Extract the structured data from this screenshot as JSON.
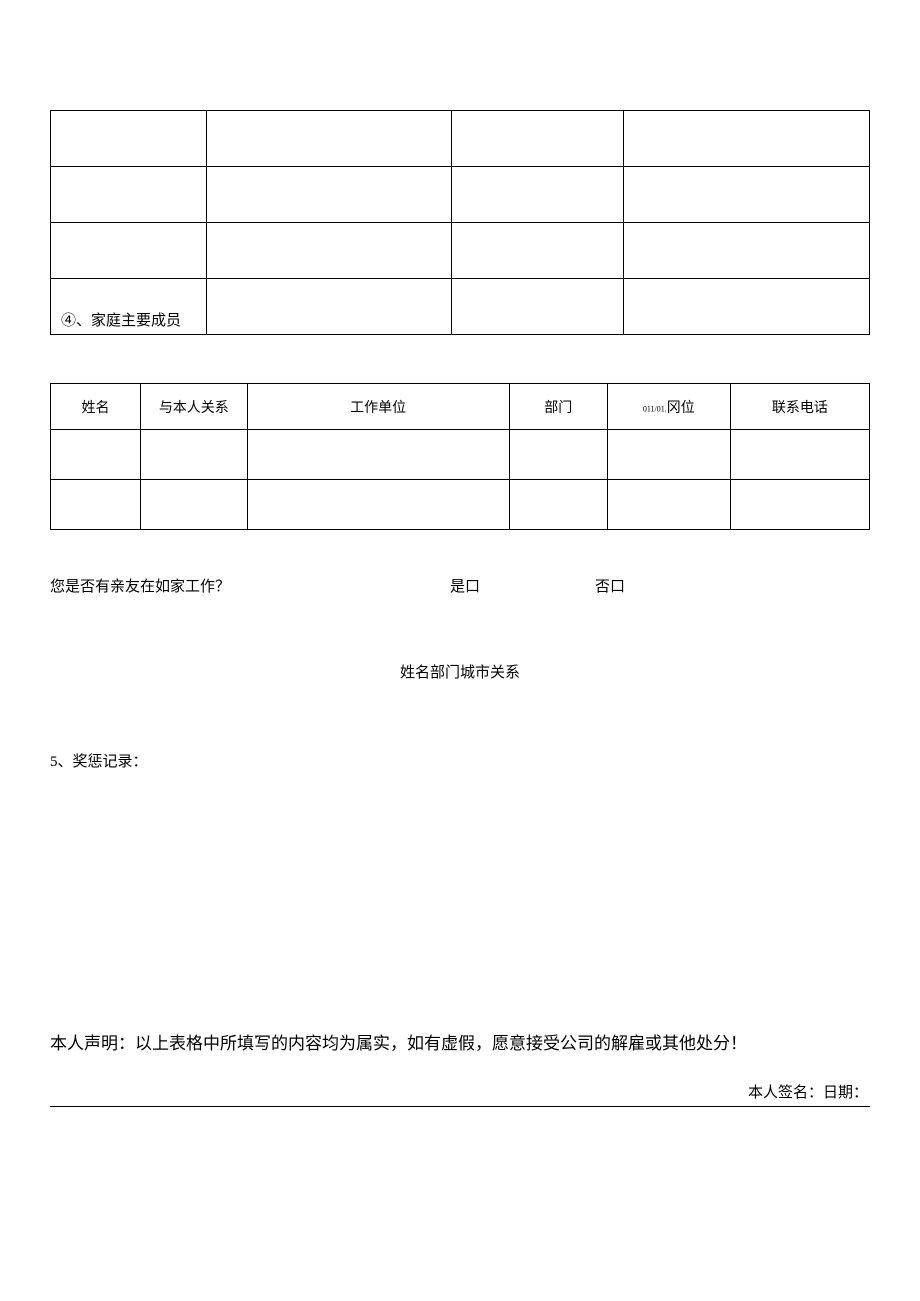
{
  "table1": {
    "section_label": "④、家庭主要成员"
  },
  "table2": {
    "headers": {
      "name": "姓名",
      "relation": "与本人关系",
      "workplace": "工作单位",
      "department": "部门",
      "position_prefix": "011/01.",
      "position": "冈位",
      "phone": "联系电话"
    }
  },
  "question": {
    "text": "您是否有亲友在如家工作？",
    "yes": "是口",
    "no": "否口"
  },
  "center_text": "姓名部门城市关系",
  "section5_label": "5、奖惩记录：",
  "declaration_text": "本人声明：以上表格中所填写的内容均为属实，如有虚假，愿意接受公司的解雇或其他处分！",
  "signature": {
    "name_label": "本人签名：",
    "date_label": "日期："
  }
}
